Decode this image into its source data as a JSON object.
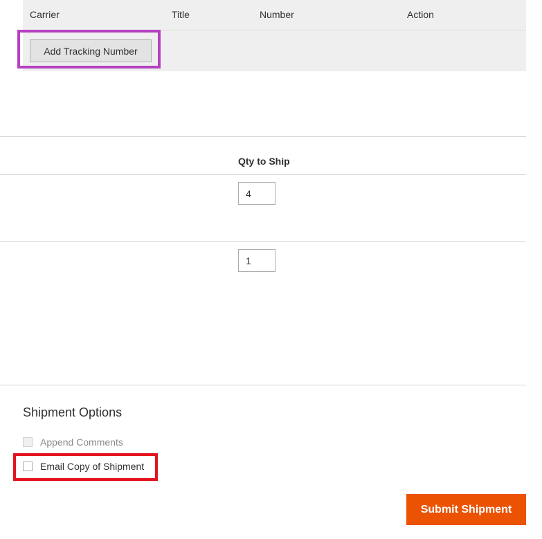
{
  "tracking": {
    "headers": {
      "carrier": "Carrier",
      "title": "Title",
      "number": "Number",
      "action": "Action"
    },
    "add_button_label": "Add Tracking Number"
  },
  "items": {
    "qty_header": "Qty to Ship",
    "rows": [
      {
        "qty": "4"
      },
      {
        "qty": "1"
      }
    ]
  },
  "shipment_options": {
    "title": "Shipment Options",
    "append_comments_label": "Append Comments",
    "email_copy_label": "Email Copy of Shipment"
  },
  "submit_label": "Submit Shipment",
  "colors": {
    "accent": "#eb5202",
    "highlight_purple": "#b541c1",
    "highlight_red": "#e3141f"
  }
}
